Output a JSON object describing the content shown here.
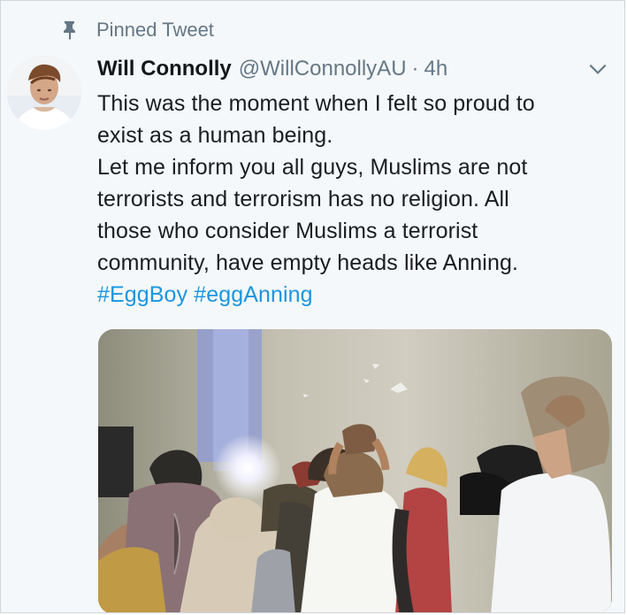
{
  "pinned_label": "Pinned Tweet",
  "tweet": {
    "display_name": "Will Connolly",
    "handle": "@WillConnollyAU",
    "separator": "·",
    "time": "4h",
    "text_lines": [
      "This was the moment when I felt so proud to",
      "exist as a human being.",
      "Let me inform you all guys, Muslims are not",
      "terrorists and terrorism has no religion. All",
      "those who consider Muslims a terrorist",
      "community, have empty heads like Anning."
    ],
    "hashtags": "#EggBoy #eggAnning"
  },
  "icons": {
    "pin": "pin-icon",
    "caret": "chevron-down-icon"
  },
  "colors": {
    "background": "#f5f8fa",
    "text": "#14171a",
    "muted": "#657786",
    "link": "#1b95e0"
  }
}
